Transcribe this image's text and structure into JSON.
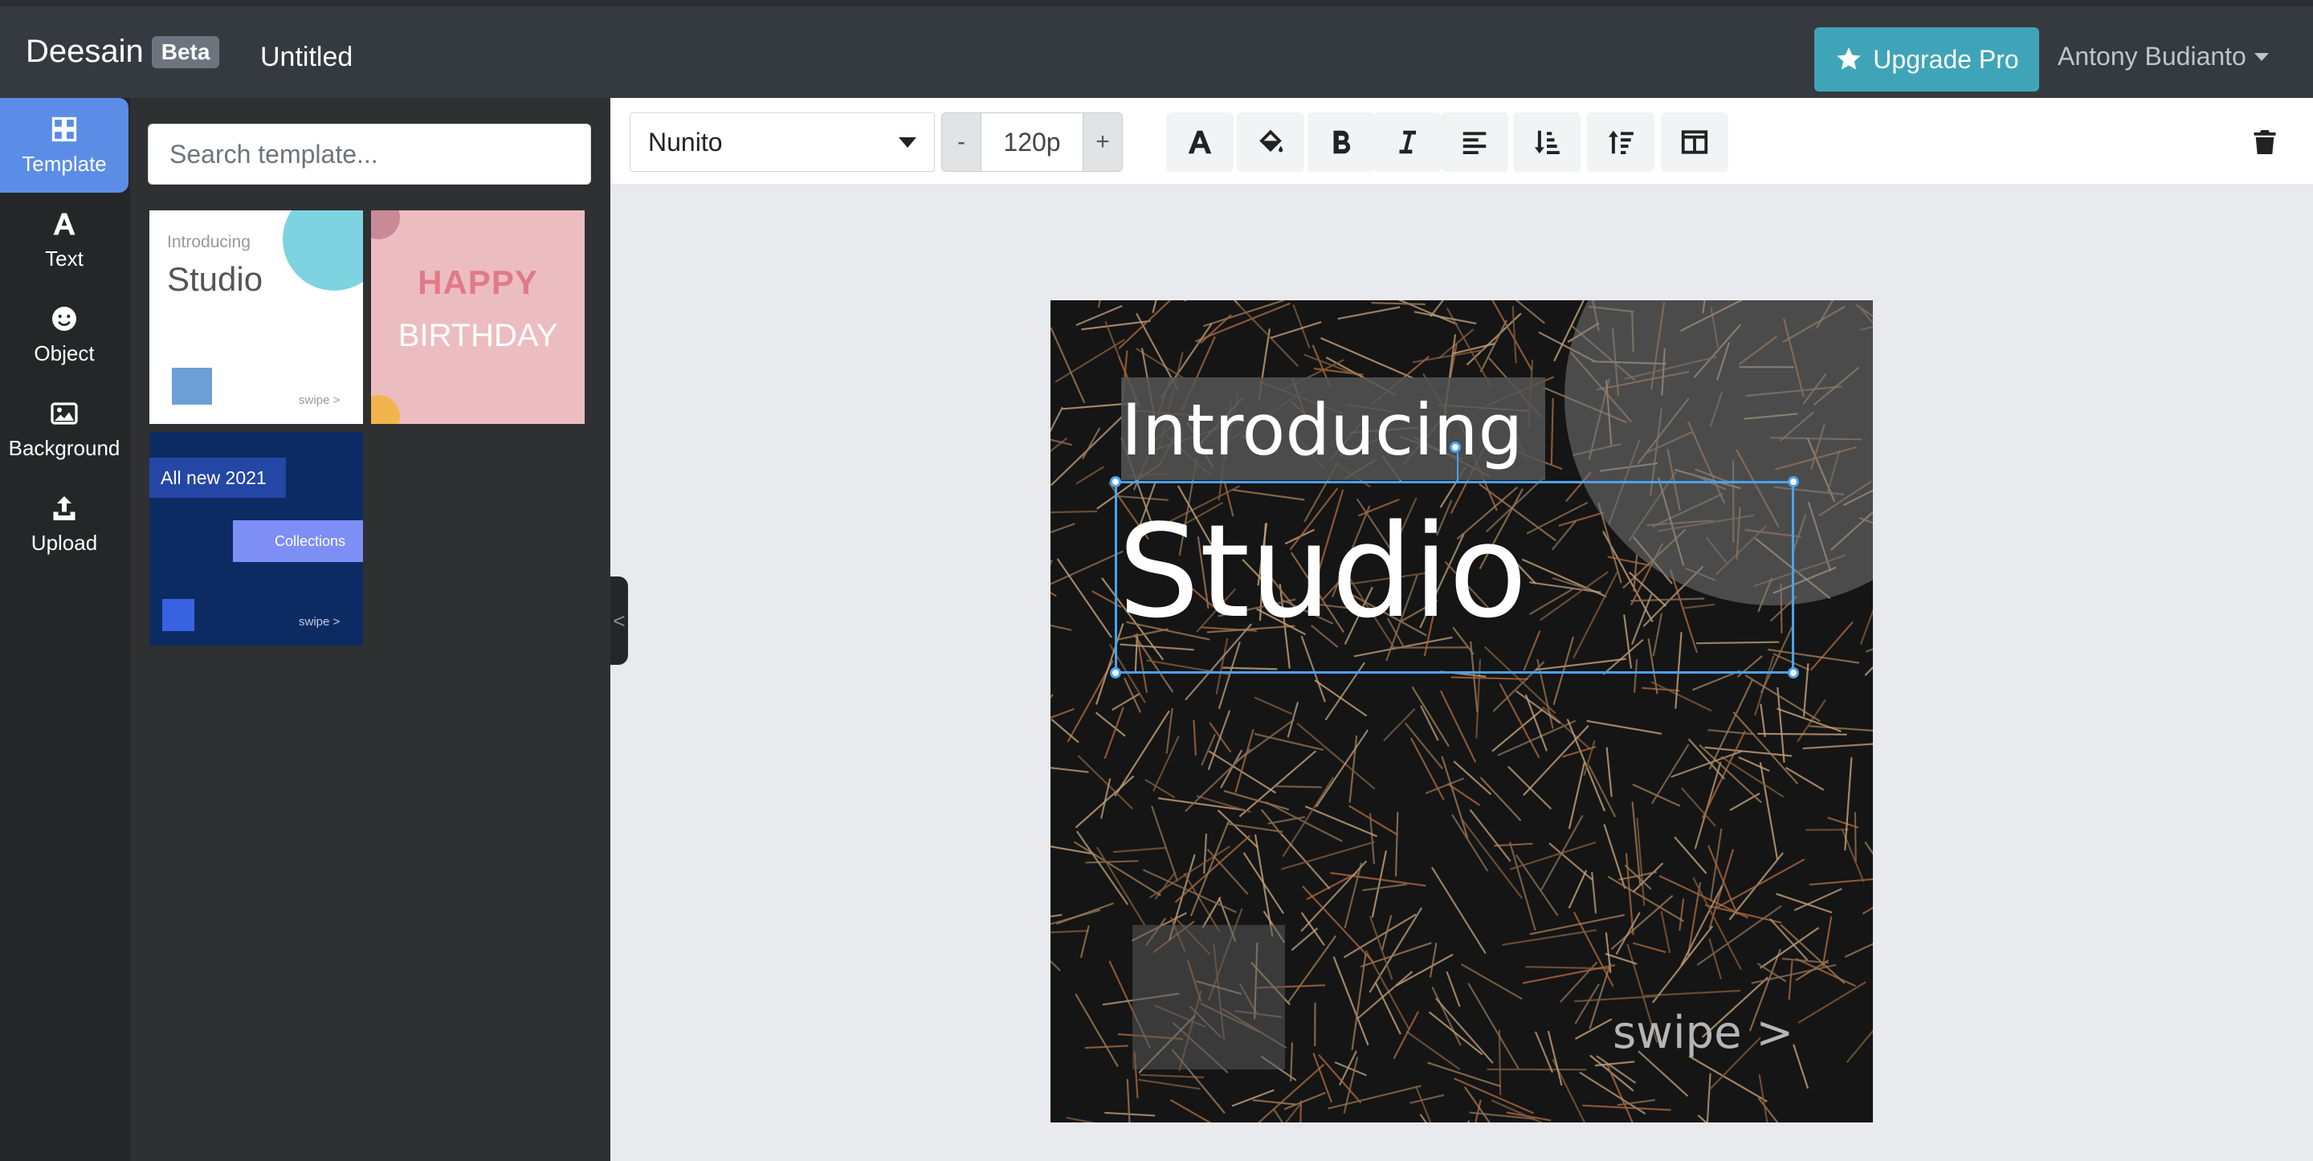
{
  "app": {
    "name": "Deesain",
    "badge": "Beta",
    "doc_title": "Untitled"
  },
  "header": {
    "upgrade_label": "Upgrade Pro",
    "user_name": "Antony Budianto"
  },
  "rail": [
    {
      "label": "Template",
      "icon": "grid-icon",
      "active": true
    },
    {
      "label": "Text",
      "icon": "text-a-icon"
    },
    {
      "label": "Object",
      "icon": "smiley-icon"
    },
    {
      "label": "Background",
      "icon": "image-icon"
    },
    {
      "label": "Upload",
      "icon": "upload-icon"
    }
  ],
  "panel": {
    "search_placeholder": "Search template...",
    "templates": [
      {
        "line1": "Introducing",
        "line2": "Studio",
        "footer": "swipe >"
      },
      {
        "line1": "HAPPY",
        "line2": "BIRTHDAY"
      },
      {
        "line1": "All new 2021",
        "line2": "Collections",
        "footer": "swipe >"
      }
    ],
    "collapse_label": "<"
  },
  "toolbar": {
    "font": "Nunito",
    "size_minus": "-",
    "size_value": "120p",
    "size_plus": "+",
    "tools": [
      "font-color-icon",
      "fill-bucket-icon",
      "bold-icon",
      "italic-icon",
      "align-left-icon",
      "sort-down-icon",
      "sort-up-icon",
      "columns-icon"
    ],
    "delete": "trash-icon"
  },
  "canvas": {
    "intro": "Introducing",
    "studio": "Studio",
    "swipe": "swipe >"
  },
  "colors": {
    "accent": "#5b8de6",
    "upgrade": "#3fa4b8",
    "navbar": "#343a40",
    "selection": "#4aa3f0"
  }
}
